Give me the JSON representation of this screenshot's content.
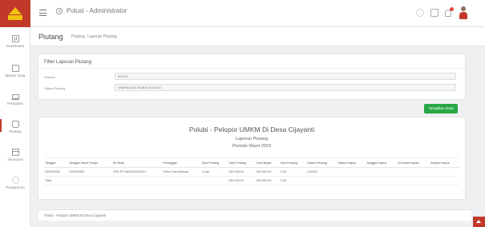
{
  "header": {
    "app_title": "Polusi - Administrator"
  },
  "sidebar": {
    "items": [
      {
        "label": "Dashboard",
        "icon": "dashboard-icon"
      },
      {
        "label": "Master Data",
        "icon": "master-data-icon"
      },
      {
        "label": "Penjualan",
        "icon": "cart-icon"
      },
      {
        "label": "Piutang",
        "icon": "bag-icon"
      },
      {
        "label": "Akuntansi",
        "icon": "archive-icon"
      },
      {
        "label": "Pengaturan",
        "icon": "settings-icon"
      }
    ]
  },
  "page": {
    "title": "Piutang",
    "breadcrumb": [
      "Piutang",
      "Laporan Piutang"
    ]
  },
  "filter": {
    "title": "Filter Laporan Piutang",
    "fields": [
      {
        "label": "Periode",
        "value": "3/2023"
      },
      {
        "label": "Status Piutang",
        "value": "TAMPILKAN SEMUA STATUS"
      }
    ],
    "show_button": "Tampilkan Data"
  },
  "report": {
    "title": "Polubi - Pelopor UMKM Di Desa Cijayanti",
    "subtitle": "Laporan Piutang",
    "period": "Periode Maret 2023",
    "columns": [
      "Tanggal",
      "Tanggal Jatuh Tempo",
      "No Bukti",
      "Pelanggan",
      "Sisa Piutang",
      "Total Piutang",
      "Total Bayar",
      "Sisa Piutang",
      "Status Piutang",
      "Status Hapus",
      "Tanggal Hapus",
      "No Bukti Hapus",
      "Alasan Hapus"
    ],
    "rows": [
      [
        "22/03/2023",
        "22/06/2023",
        "TRX-PP-08032023/2021",
        "Shea Putri Adriana",
        "3 hari",
        "250.000,00",
        "250.000,00",
        "0,00",
        "LUNAS",
        "-",
        "-",
        "-",
        "-"
      ]
    ],
    "total": {
      "label": "Total",
      "total_piutang": "250.000,00",
      "total_bayar": "250.000,00",
      "sisa": "0,00"
    }
  },
  "footer": {
    "text": "Polubi - Pelopor UMKM Di Desa Cijayanti"
  },
  "colors": {
    "brand": "#c0392b",
    "success": "#28a745"
  }
}
